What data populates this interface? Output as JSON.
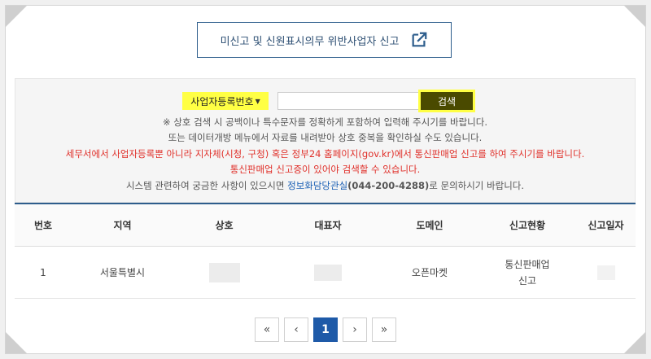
{
  "report_button": {
    "label": "미신고 및 신원표시의무 위반사업자 신고",
    "icon": "external-link-icon"
  },
  "search": {
    "select_value": "사업자등록번호",
    "input_value": "",
    "button_label": "검색",
    "highlight_color": "#ffff44"
  },
  "notes": {
    "line1": "※ 상호 검색 시 공백이나 특수문자를 정확하게 포함하여 입력해 주시기를 바랍니다.",
    "line2": "또는 데이터개방 메뉴에서 자료를 내려받아 상호 중복을 확인하실 수도 있습니다.",
    "line3": "세무서에서 사업자등록뿐 아니라 지자체(시청, 구청) 혹은 정부24 홈페이지(gov.kr)에서 통신판매업 신고를 하여 주시기를 바랍니다.",
    "line4": "통신판매업 신고증이 있어야 검색할 수 있습니다.",
    "line5_prefix": "시스템 관련하여 궁금한 사항이 있으시면 ",
    "line5_link": "정보화담당관실",
    "line5_phone": "(044-200-4288)",
    "line5_suffix": "로 문의하시기 바랍니다."
  },
  "table": {
    "headers": [
      "번호",
      "지역",
      "상호",
      "대표자",
      "도메인",
      "신고현황",
      "신고일자"
    ],
    "rows": [
      {
        "no": "1",
        "region": "서울특별시",
        "name": "",
        "rep": "",
        "domain": "오픈마켓",
        "status_line1": "통신판매업",
        "status_line2": "신고",
        "date": ""
      }
    ]
  },
  "pagination": {
    "first": "«",
    "prev": "‹",
    "current": "1",
    "next": "›",
    "last": "»"
  },
  "colors": {
    "accent": "#2d5d8c",
    "active_page": "#1e5aa8",
    "warning_text": "#e0302a",
    "link": "#1a5fb4"
  }
}
